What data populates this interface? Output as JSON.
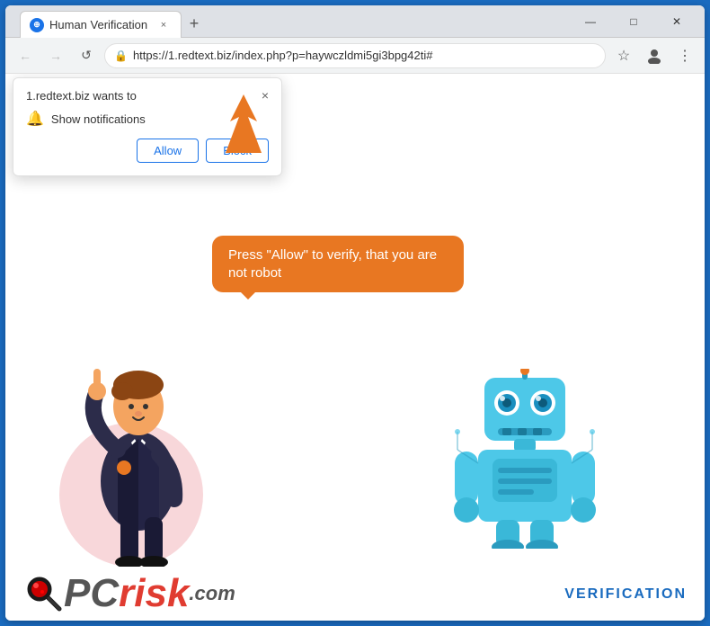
{
  "browser": {
    "tab_title": "Human Verification",
    "url": "https://1.redtext.biz/index.php?p=haywczldmi5gi3bpg42ti#",
    "new_tab_label": "+",
    "close_tab_label": "×"
  },
  "window_controls": {
    "minimize": "—",
    "maximize": "□",
    "close": "✕"
  },
  "nav": {
    "back": "←",
    "forward": "→",
    "refresh": "↺"
  },
  "notification_popup": {
    "title": "1.redtext.biz wants to",
    "notification_label": "Show notifications",
    "close_label": "×",
    "allow_label": "Allow",
    "block_label": "Block"
  },
  "speech_bubble": {
    "text": "Press \"Allow\" to verify, that you are not robot"
  },
  "pcrisk": {
    "pc_text": "PC",
    "risk_text": "risk",
    "com_text": ".com"
  },
  "verification": {
    "label": "VERIFICATION"
  }
}
